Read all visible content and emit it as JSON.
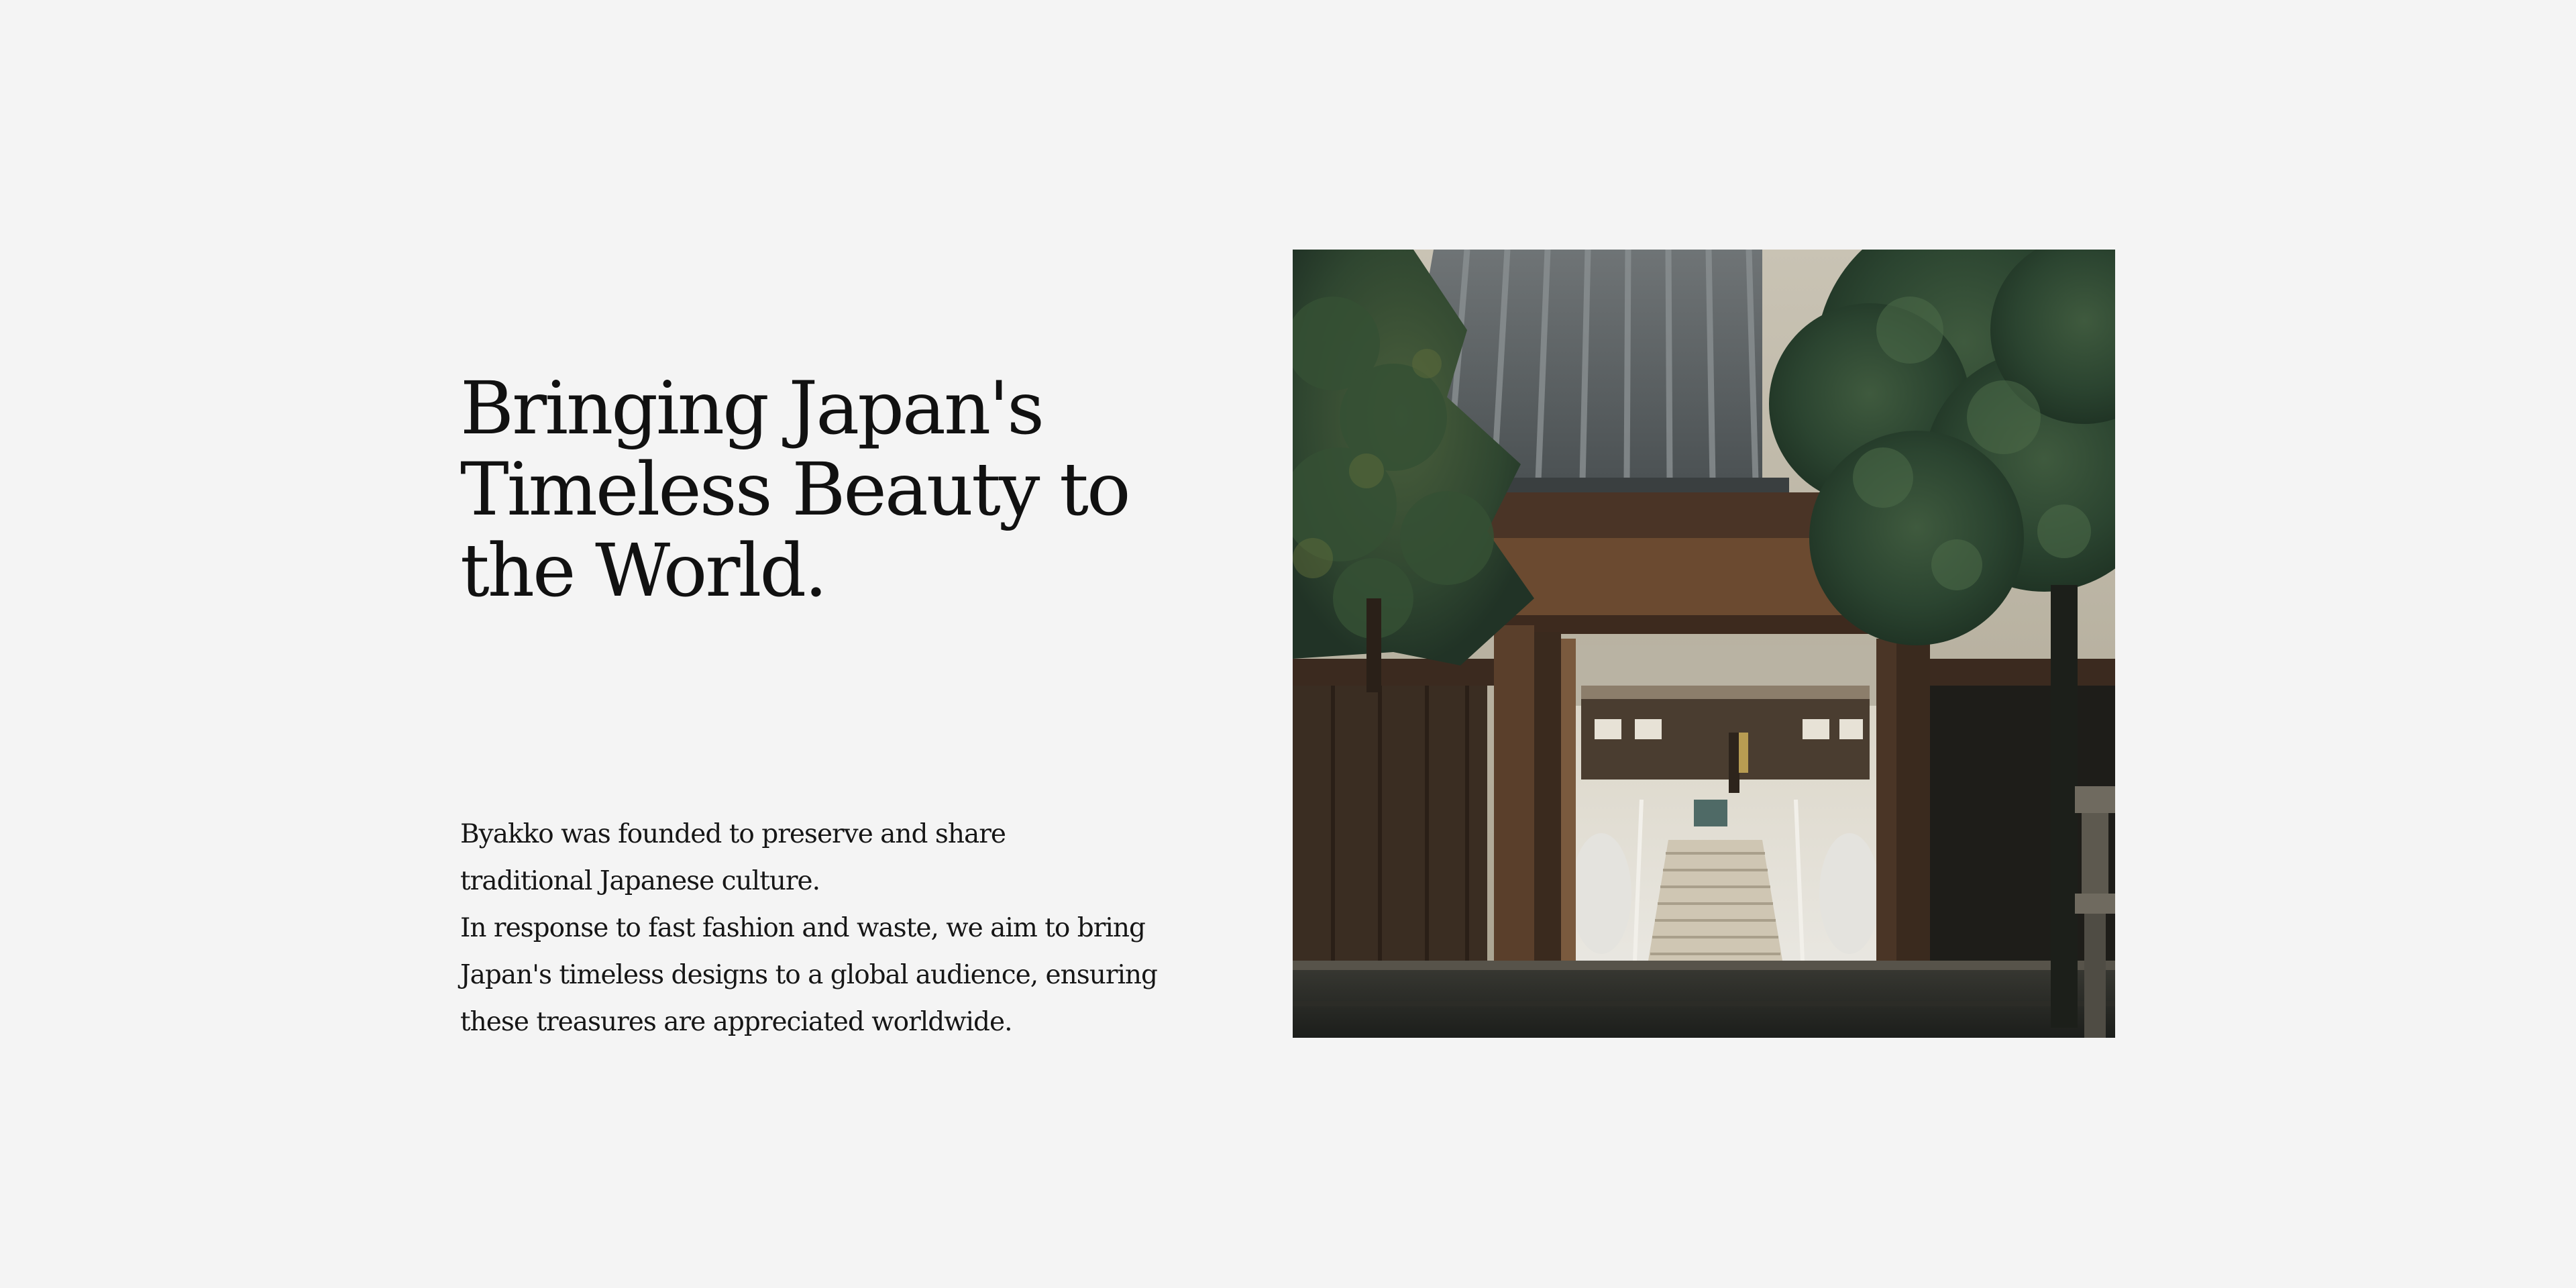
{
  "hero": {
    "headline_lines": [
      "Bringing Japan's",
      "Timeless Beauty to",
      "the World."
    ],
    "body_lines": [
      "Byakko was founded to preserve and share",
      "traditional Japanese culture.",
      "In response to fast fashion and waste, we aim to bring",
      "Japan's timeless designs to a global audience, ensuring",
      "these treasures are appreciated worldwide."
    ]
  },
  "image": {
    "subject": "temple-gate-photo"
  },
  "colors": {
    "background": "#f4f4f4",
    "text": "#111111"
  }
}
